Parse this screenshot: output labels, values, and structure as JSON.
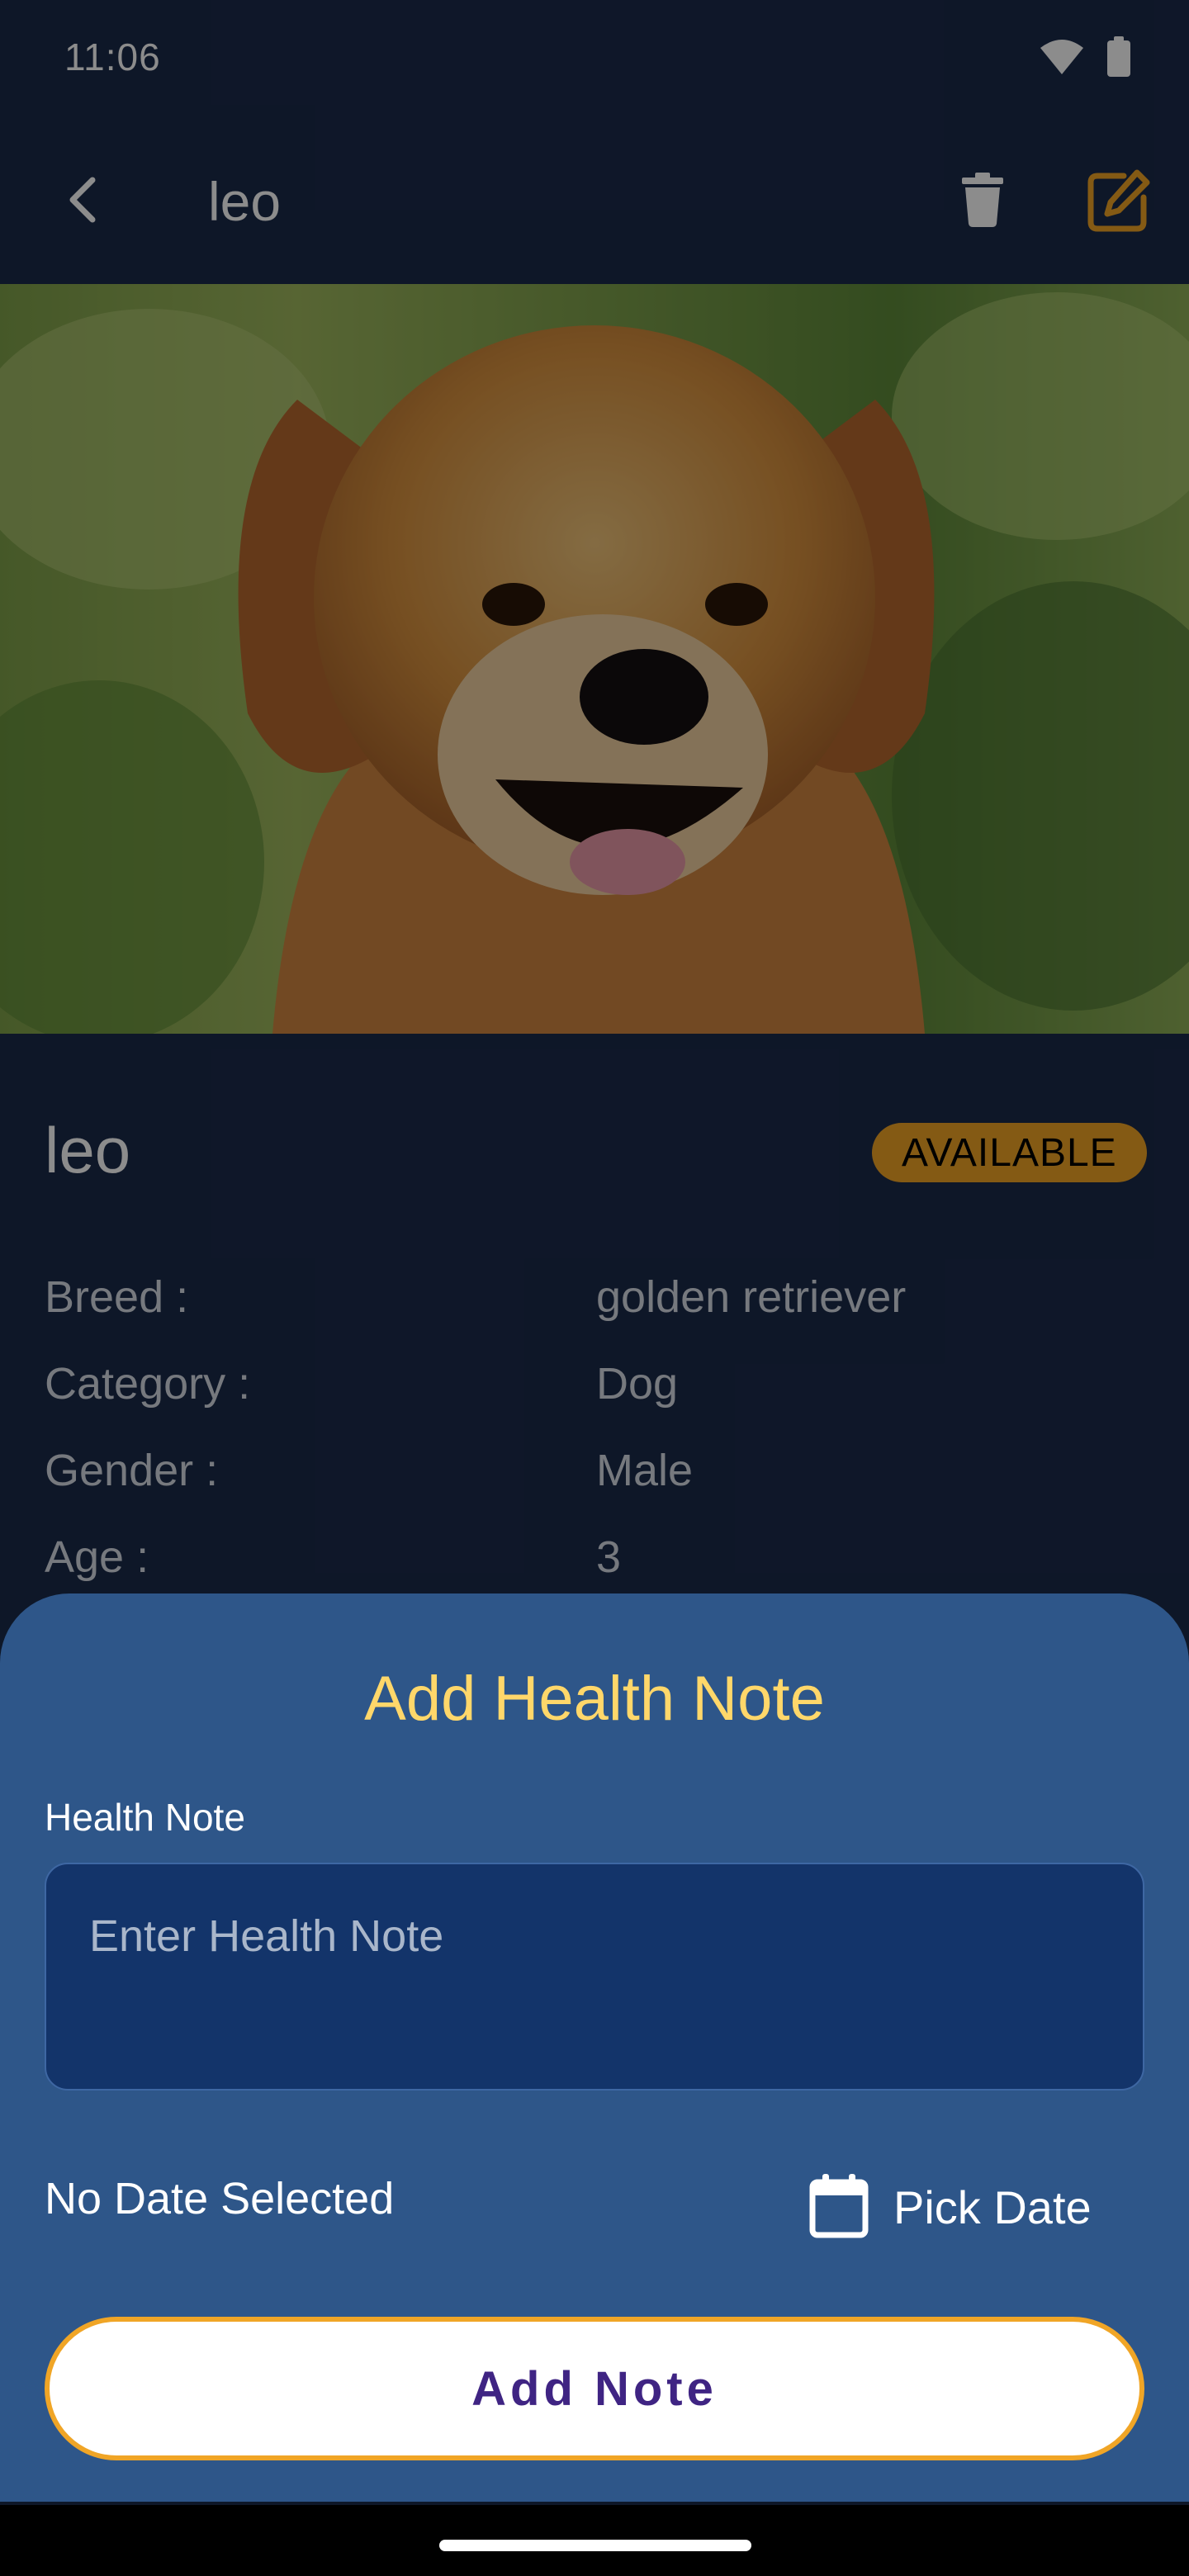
{
  "status_bar": {
    "time": "11:06"
  },
  "app_bar": {
    "title": "leo"
  },
  "pet": {
    "name": "leo",
    "status_badge": "AVAILABLE",
    "details": [
      {
        "label": "Breed :",
        "value": "golden retriever"
      },
      {
        "label": "Category :",
        "value": "Dog"
      },
      {
        "label": "Gender :",
        "value": "Male"
      },
      {
        "label": "Age :",
        "value": "3"
      }
    ]
  },
  "sheet": {
    "title": "Add Health Note",
    "field_label": "Health Note",
    "note_placeholder": "Enter Health Note",
    "note_value": "",
    "date_text": "No Date Selected",
    "pick_date_label": "Pick Date",
    "add_button_label": "Add Note"
  },
  "colors": {
    "background": "#1b2a4a",
    "sheet": "#2e5689",
    "accent": "#f0a526",
    "title": "#ffd76a",
    "button_text": "#3f2483"
  }
}
